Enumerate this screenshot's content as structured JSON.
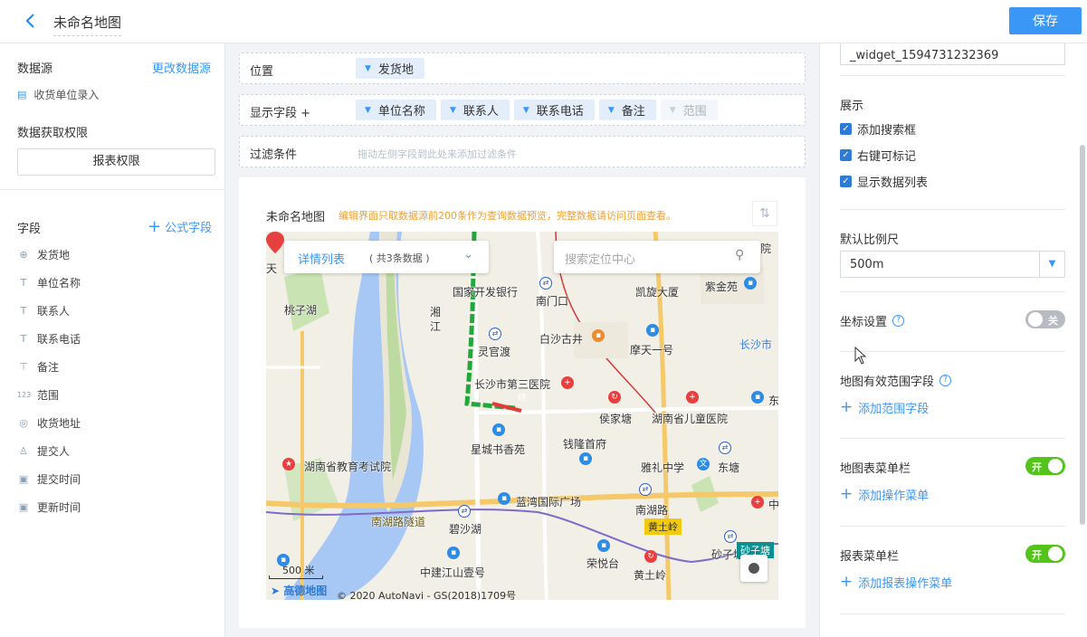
{
  "header": {
    "title": "未命名地图",
    "save_label": "保存"
  },
  "left": {
    "datasource_title": "数据源",
    "change_datasource": "更改数据源",
    "datasource_item": "收货单位录入",
    "permission_title": "数据获取权限",
    "permission_button": "报表权限",
    "fields_title": "字段",
    "formula_field": "公式字段",
    "fields": [
      {
        "icon": "location-icon",
        "glyph": "⊕",
        "label": "发货地"
      },
      {
        "icon": "text-icon",
        "glyph": "T",
        "label": "单位名称"
      },
      {
        "icon": "text-icon",
        "glyph": "T",
        "label": "联系人"
      },
      {
        "icon": "text-icon",
        "glyph": "T",
        "label": "联系电话"
      },
      {
        "icon": "multiline-text-icon",
        "glyph": "⊤",
        "label": "备注"
      },
      {
        "icon": "number-icon",
        "glyph": "123",
        "label": "范围"
      },
      {
        "icon": "address-pin-icon",
        "glyph": "◎",
        "label": "收货地址"
      },
      {
        "icon": "user-icon",
        "glyph": "♙",
        "label": "提交人"
      },
      {
        "icon": "calendar-icon",
        "glyph": "▣",
        "label": "提交时间"
      },
      {
        "icon": "calendar-icon",
        "glyph": "▣",
        "label": "更新时间"
      }
    ]
  },
  "config": {
    "position_label": "位置",
    "position_chips": [
      "发货地"
    ],
    "display_label": "显示字段 +",
    "display_chips": [
      "单位名称",
      "联系人",
      "联系电话",
      "备注"
    ],
    "display_faded_chip": "范围",
    "filter_label": "过滤条件",
    "filter_hint": "拖动左侧字段到此处来添加过滤条件"
  },
  "preview": {
    "title": "未命名地图",
    "warning": "编辑界面只取数据源前200条作为查询数据预览，完整数据请访问页面查看。",
    "detail_list": "详情列表",
    "detail_count": "( 共3条数据 )",
    "search_placeholder": "搜索定位中心",
    "scale": "500 米",
    "logo": "高德地图",
    "copyright": "© 2020 AutoNavi - GS(2018)1709号",
    "end_marker": "终",
    "labels": {
      "l1": "国家开发银行",
      "l2": "南门口",
      "l3": "凯旋大厦",
      "l4": "紫金苑",
      "l5": "桃子湖",
      "l6": "湘",
      "l7": "江",
      "l8": "灵官渡",
      "l9": "白沙古井",
      "l10": "摩天一号",
      "l11": "长沙市第三医院",
      "l12": "侯家塘",
      "l13": "湖南省儿童医院",
      "l14": "星城书香苑",
      "l15": "钱隆首府",
      "l16": "雅礼中学",
      "l17": "东塘",
      "l18": "湖南省教育考试院",
      "l19": "蓝湾国际广场",
      "l20": "南湖路",
      "l21": "黄土岭",
      "l22": "南湖路隧道",
      "l23": "碧沙湖",
      "l24": "荣悦台",
      "l25": "砂子塘",
      "l26": "中建江山壹号",
      "l27": "黄土岭",
      "l28": "长沙市",
      "l29": "东",
      "l30": "中",
      "l31": "院",
      "l32": "天",
      "l33": "砂子塘"
    }
  },
  "right": {
    "widget_id": "_widget_1594731232369",
    "display_title": "展示",
    "checkboxes": [
      "添加搜索框",
      "右键可标记",
      "显示数据列表"
    ],
    "scale_title": "默认比例尺",
    "scale_value": "500m",
    "coord_title": "坐标设置",
    "coord_toggle": "关",
    "range_title": "地图有效范围字段",
    "range_add": "添加范围字段",
    "map_menu_title": "地图表菜单栏",
    "map_menu_toggle": "开",
    "map_menu_add": "添加操作菜单",
    "report_menu_title": "报表菜单栏",
    "report_menu_toggle": "开",
    "report_menu_add": "添加报表操作菜单"
  }
}
